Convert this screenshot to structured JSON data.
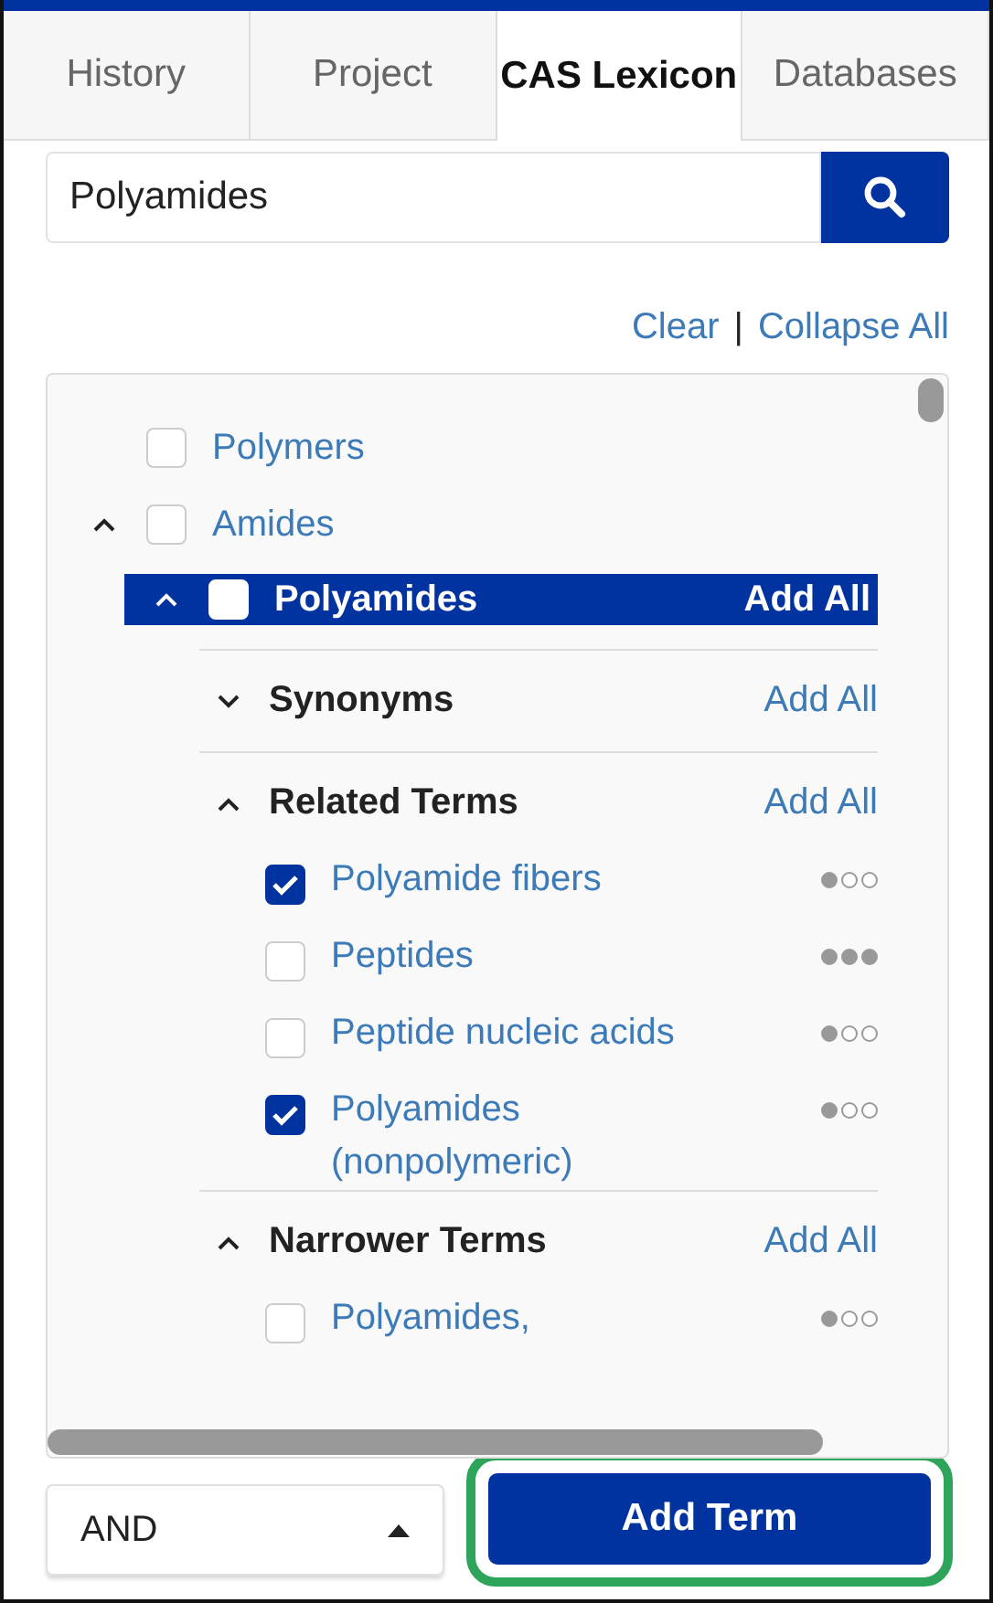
{
  "tabs": [
    {
      "label": "History",
      "selected": false
    },
    {
      "label": "Project",
      "selected": false
    },
    {
      "label": "CAS Lexicon",
      "selected": true
    },
    {
      "label": "Databases",
      "selected": false
    }
  ],
  "search": {
    "value": "Polyamides"
  },
  "links": [
    "Clear",
    "Collapse All"
  ],
  "link_separator": "|",
  "tree": [
    {
      "kind": "leaf",
      "label": "Polymers",
      "checked": false,
      "selected": false
    },
    {
      "kind": "node",
      "label": "Amides",
      "checked": false,
      "selected": false,
      "expanded": true,
      "children": [
        {
          "kind": "node",
          "label": "Polyamides",
          "checked": false,
          "selected": true,
          "expanded": true,
          "action": "Add All",
          "sections": [
            {
              "title": "Synonyms",
              "expanded": false,
              "action": "Add All"
            },
            {
              "title": "Related Terms",
              "expanded": true,
              "action": "Add All",
              "terms": [
                {
                  "label": "Polyamide fibers",
                  "checked": true,
                  "stars": 1
                },
                {
                  "label": "Peptides",
                  "checked": false,
                  "stars": 3
                },
                {
                  "label": "Peptide nucleic acids",
                  "checked": false,
                  "stars": 1
                },
                {
                  "label": "Polyamides (nonpolymeric)",
                  "checked": true,
                  "stars": 1
                }
              ]
            },
            {
              "title": "Narrower Terms",
              "expanded": true,
              "action": "Add All",
              "terms": [
                {
                  "label": "Polyamides,",
                  "checked": false,
                  "stars": 1
                }
              ]
            }
          ]
        }
      ]
    }
  ],
  "operator": {
    "value": "AND"
  },
  "add_button": {
    "label": "Add Term",
    "highlighted": true
  }
}
